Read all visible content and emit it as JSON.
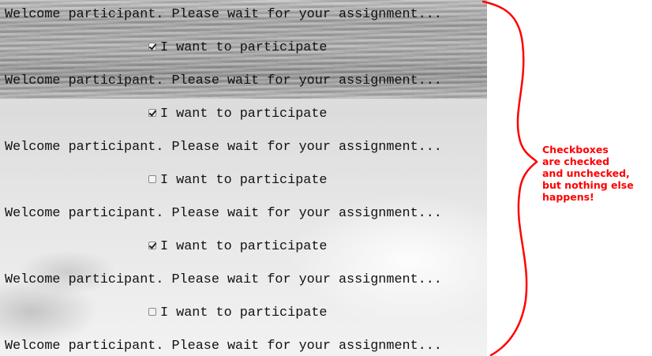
{
  "welcome_text": "Welcome participant. Please wait for your assignment...",
  "checkbox_label": "I want to participate",
  "rows": [
    {
      "type": "welcome"
    },
    {
      "type": "checkbox",
      "checked": true
    },
    {
      "type": "welcome"
    },
    {
      "type": "checkbox",
      "checked": true
    },
    {
      "type": "welcome"
    },
    {
      "type": "checkbox",
      "checked": false
    },
    {
      "type": "welcome"
    },
    {
      "type": "checkbox",
      "checked": true
    },
    {
      "type": "welcome"
    },
    {
      "type": "checkbox",
      "checked": false
    },
    {
      "type": "welcome"
    }
  ],
  "annotation": {
    "lines": [
      "Checkboxes",
      "are checked",
      "and unchecked,",
      "but nothing else",
      "happens!"
    ],
    "color": "#ff0000"
  }
}
